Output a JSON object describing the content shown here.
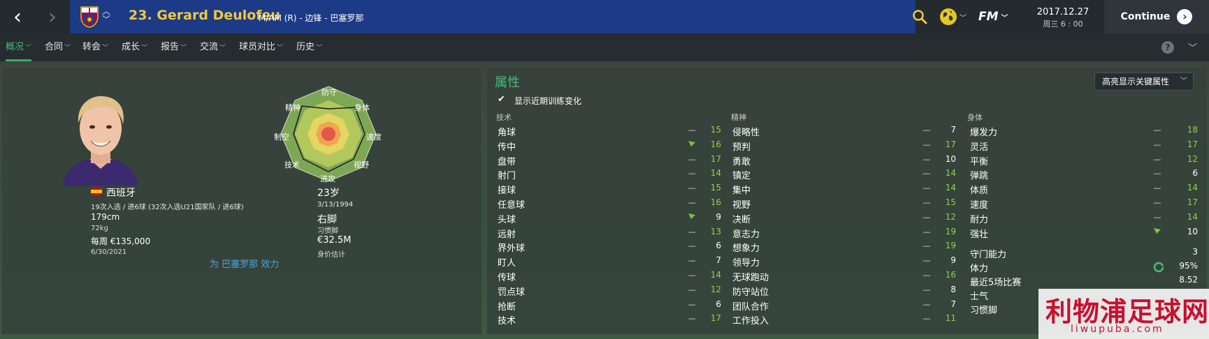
{
  "window": {
    "player_title": "23. Gerard Deulofeu",
    "player_sub": "M/AM (R) - 边锋 - 巴塞罗那",
    "date_main": "2017.12.27",
    "date_sub": "周三 6 : 00",
    "continue_label": "Continue",
    "fm_label": "FM"
  },
  "tabs": [
    {
      "label": "概况",
      "active": true
    },
    {
      "label": "合同"
    },
    {
      "label": "转会"
    },
    {
      "label": "成长"
    },
    {
      "label": "报告"
    },
    {
      "label": "交流"
    },
    {
      "label": "球员对比"
    },
    {
      "label": "历史"
    }
  ],
  "profile": {
    "nation": "西班牙",
    "caps": "19次入选 / 进6球 (32次入选U21国家队 / 进6球)",
    "height": "179cm",
    "weight": "72kg",
    "wage": "每周 €135,000",
    "contract": "6/30/2021",
    "age": "23岁",
    "dob": "3/13/1994",
    "foot": "右脚",
    "foot_label": "习惯脚",
    "value": "€32.5M",
    "value_label": "身价估计",
    "plays_for": "为 巴塞罗那 效力"
  },
  "radar": {
    "labels": {
      "top": "防守",
      "top_right": "身体",
      "right": "速度",
      "bottom_right": "视野",
      "bottom": "进攻",
      "bottom_left": "技术",
      "left": "制空",
      "top_left": "精神"
    }
  },
  "attributes": {
    "title": "属性",
    "highlight_button": "高亮显示关键属性",
    "show_training_label": "显示近期训练变化",
    "show_training_checked": true,
    "technical": {
      "heading": "技术",
      "rows": [
        {
          "name": "角球",
          "trend": "flat",
          "value": "15"
        },
        {
          "name": "传中",
          "trend": "up",
          "value": "16"
        },
        {
          "name": "盘带",
          "trend": "flat",
          "value": "17"
        },
        {
          "name": "射门",
          "trend": "flat",
          "value": "14"
        },
        {
          "name": "接球",
          "trend": "flat",
          "value": "15"
        },
        {
          "name": "任意球",
          "trend": "flat",
          "value": "16"
        },
        {
          "name": "头球",
          "trend": "up",
          "value": "9"
        },
        {
          "name": "远射",
          "trend": "flat",
          "value": "13"
        },
        {
          "name": "界外球",
          "trend": "flat",
          "value": "6"
        },
        {
          "name": "盯人",
          "trend": "flat",
          "value": "7"
        },
        {
          "name": "传球",
          "trend": "flat",
          "value": "14"
        },
        {
          "name": "罚点球",
          "trend": "flat",
          "value": "12"
        },
        {
          "name": "抢断",
          "trend": "flat",
          "value": "6"
        },
        {
          "name": "技术",
          "trend": "flat",
          "value": "17"
        }
      ]
    },
    "mental": {
      "heading": "精神",
      "rows": [
        {
          "name": "侵略性",
          "trend": "flat",
          "value": "7"
        },
        {
          "name": "预判",
          "trend": "flat",
          "value": "17"
        },
        {
          "name": "勇敢",
          "trend": "flat",
          "value": "10"
        },
        {
          "name": "镇定",
          "trend": "flat",
          "value": "14"
        },
        {
          "name": "集中",
          "trend": "flat",
          "value": "14"
        },
        {
          "name": "视野",
          "trend": "flat",
          "value": "15"
        },
        {
          "name": "决断",
          "trend": "flat",
          "value": "12"
        },
        {
          "name": "意志力",
          "trend": "flat",
          "value": "19"
        },
        {
          "name": "想象力",
          "trend": "flat",
          "value": "19"
        },
        {
          "name": "领导力",
          "trend": "flat",
          "value": "9"
        },
        {
          "name": "无球跑动",
          "trend": "flat",
          "value": "16"
        },
        {
          "name": "防守站位",
          "trend": "flat",
          "value": "8"
        },
        {
          "name": "团队合作",
          "trend": "flat",
          "value": "7"
        },
        {
          "name": "工作投入",
          "trend": "flat",
          "value": "11"
        }
      ]
    },
    "physical": {
      "heading": "身体",
      "rows": [
        {
          "name": "爆发力",
          "trend": "flat",
          "value": "18"
        },
        {
          "name": "灵活",
          "trend": "flat",
          "value": "17"
        },
        {
          "name": "平衡",
          "trend": "flat",
          "value": "12"
        },
        {
          "name": "弹跳",
          "trend": "flat",
          "value": "6"
        },
        {
          "name": "体质",
          "trend": "flat",
          "value": "14"
        },
        {
          "name": "速度",
          "trend": "flat",
          "value": "17"
        },
        {
          "name": "耐力",
          "trend": "flat",
          "value": "14"
        },
        {
          "name": "强壮",
          "trend": "up",
          "value": "10"
        }
      ]
    },
    "misc": [
      {
        "label": "守门能力",
        "value": "3"
      },
      {
        "label": "体力",
        "value": "95%"
      },
      {
        "label": "最近5场比赛",
        "value": "8.52"
      },
      {
        "label": "士气",
        "value": ""
      },
      {
        "label": "习惯脚",
        "value": ""
      }
    ]
  },
  "watermark": {
    "top": "利物浦足球网",
    "bottom": "liwupuba.com"
  },
  "colors": {
    "accent_green": "#4cbb7a",
    "value_green": "#8fd14f",
    "value_white": "#ffffff",
    "title_yellow": "#f0c93a",
    "title_bar_blue": "#1d3a86",
    "link_blue": "#4aa3e0"
  },
  "icons": {
    "back": "chevron-left-icon",
    "forward": "chevron-right-icon",
    "search": "search-icon",
    "globe": "globe-icon",
    "help": "help-icon",
    "check": "check-icon"
  }
}
